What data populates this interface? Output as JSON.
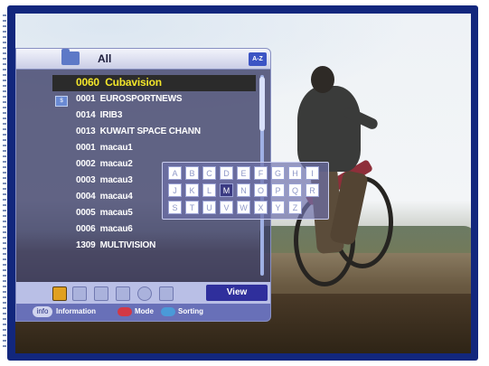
{
  "panel": {
    "group_title": "All",
    "sort_button": "A-Z",
    "channels": [
      {
        "number": "0060",
        "name": "Cubavision",
        "selected": true
      },
      {
        "number": "0001",
        "name": "EUROSPORTNEWS",
        "scrambled": true
      },
      {
        "number": "0014",
        "name": "IRIB3"
      },
      {
        "number": "0013",
        "name": "KUWAIT SPACE CHANN"
      },
      {
        "number": "0001",
        "name": "macau1"
      },
      {
        "number": "0002",
        "name": "macau2"
      },
      {
        "number": "0003",
        "name": "macau3"
      },
      {
        "number": "0004",
        "name": "macau4"
      },
      {
        "number": "0005",
        "name": "macau5"
      },
      {
        "number": "0006",
        "name": "macau6"
      },
      {
        "number": "1309",
        "name": "MULTIVISION"
      }
    ],
    "toolbar": {
      "view_label": "View",
      "icons": [
        "tv-radio-icon",
        "lock-icon",
        "move-icon",
        "folder-icon",
        "skip-icon",
        "edit-icon"
      ]
    },
    "help": {
      "info_key": "info",
      "info_label": "Information",
      "red_label": "Mode",
      "blue_label": "Sorting"
    }
  },
  "keyboard": {
    "rows": [
      [
        "A",
        "B",
        "C",
        "D",
        "E",
        "F",
        "G",
        "H",
        "I"
      ],
      [
        "J",
        "K",
        "L",
        "M",
        "N",
        "O",
        "P",
        "Q",
        "R"
      ],
      [
        "S",
        "T",
        "U",
        "V",
        "W",
        "X",
        "Y",
        "Z"
      ]
    ],
    "active_key": "M"
  },
  "colors": {
    "frame": "#12277d",
    "selected_text": "#f2e52a",
    "view_button": "#2f2f9c",
    "red_key": "#d33845",
    "blue_key": "#4a9ad8"
  }
}
